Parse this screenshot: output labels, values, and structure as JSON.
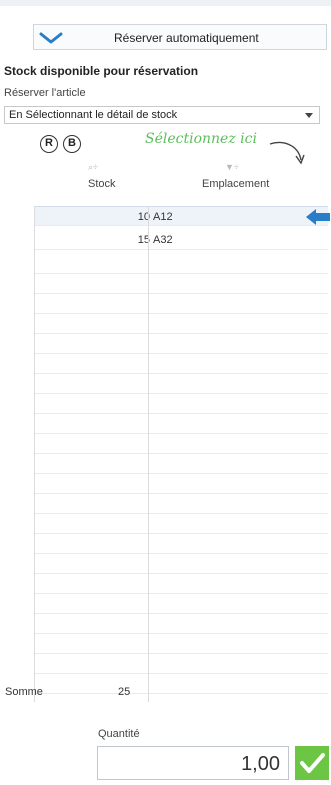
{
  "header": {
    "auto_reserve_label": "Réserver automatiquement",
    "chevron_icon": "chevron-down-icon"
  },
  "stock": {
    "title": "Stock disponible pour réservation",
    "reserve_label": "Réserver l'article",
    "select_value": "En Sélectionnant le détail de stock",
    "badge_r": "R",
    "badge_b": "B",
    "hint": "Sélectionnez ici",
    "columns": [
      {
        "label": "Stock",
        "icon": "search-icon",
        "icon_glyph": "⌕÷"
      },
      {
        "label": "Emplacement",
        "icon": "filter-icon",
        "icon_glyph": "▼÷"
      }
    ],
    "rows": [
      {
        "stock": "10",
        "location": "A12"
      },
      {
        "stock": "15",
        "location": "A32"
      }
    ],
    "sum_label": "Somme",
    "sum_value": "25"
  },
  "quantity": {
    "label": "Quantité",
    "value": "1,00",
    "confirm_icon": "check-icon"
  },
  "colors": {
    "accent": "#2a7ec8",
    "hint": "#5cbf5c",
    "confirm": "#6cc644"
  }
}
